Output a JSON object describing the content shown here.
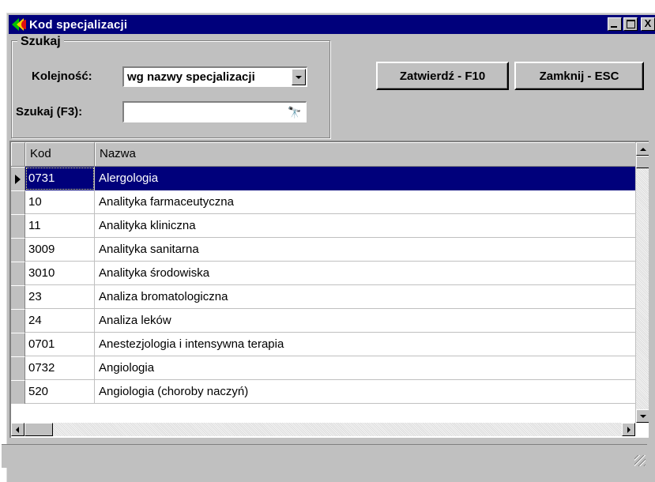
{
  "window": {
    "title": "Kod specjalizacji",
    "buttons": {
      "minimize": "_",
      "maximize": "□",
      "close": "X"
    }
  },
  "search_group": {
    "legend": "Szukaj",
    "order_label": "Kolejność:",
    "order_value": "wg nazwy specjalizacji",
    "search_label": "Szukaj (F3):",
    "search_value": ""
  },
  "actions": {
    "confirm_label": "Zatwierdź - F10",
    "close_label": "Zamknij - ESC"
  },
  "grid": {
    "columns": [
      "Kod",
      "Nazwa"
    ],
    "selected_index": 0,
    "rows": [
      {
        "kod": "0731",
        "nazwa": "Alergologia"
      },
      {
        "kod": "10",
        "nazwa": "Analityka farmaceutyczna"
      },
      {
        "kod": "11",
        "nazwa": "Analityka kliniczna"
      },
      {
        "kod": "3009",
        "nazwa": "Analityka sanitarna"
      },
      {
        "kod": "3010",
        "nazwa": "Analityka środowiska"
      },
      {
        "kod": "23",
        "nazwa": "Analiza bromatologiczna"
      },
      {
        "kod": "24",
        "nazwa": "Analiza leków"
      },
      {
        "kod": "0701",
        "nazwa": "Anestezjologia i intensywna terapia"
      },
      {
        "kod": "0732",
        "nazwa": "Angiologia"
      },
      {
        "kod": "520",
        "nazwa": "Angiologia (choroby naczyń)"
      }
    ]
  },
  "colors": {
    "title_bar": "#00007b",
    "selection": "#00007b",
    "face": "#c0c0c0"
  },
  "icons": {
    "app": "app-logo-icon",
    "search": "binoculars-icon"
  }
}
